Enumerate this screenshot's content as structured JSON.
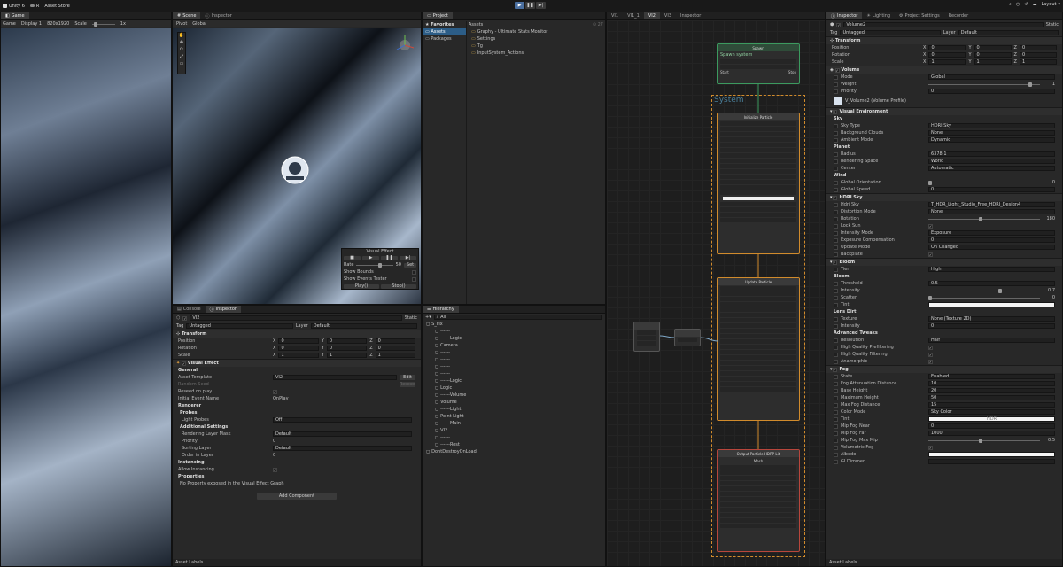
{
  "topbar": {
    "app": "Unity 6",
    "account": "R",
    "store": "Asset Store",
    "layout": "Layout"
  },
  "game": {
    "tab": "Game",
    "mode": "Game",
    "display": "Display 1",
    "res": "820x1920",
    "scale": "Scale",
    "scale_val": "1x"
  },
  "scene": {
    "tab_scene": "Scene",
    "tab_inspector": "Inspector",
    "pivot": "Pivot",
    "global": "Global",
    "persp": "Persp"
  },
  "vfx_overlay": {
    "title": "Visual Effect",
    "rate": "Rate",
    "rate_val": "50",
    "set": "Set",
    "show_bounds": "Show Bounds",
    "show_events": "Show Events Tester",
    "play": "Play()",
    "stop": "Stop()"
  },
  "project": {
    "tab": "Project",
    "favorites": "Favorites",
    "assets": "Assets",
    "packages": "Packages",
    "count": "27",
    "crumb": "Assets",
    "items": [
      "Graphy - Ultimate Stats Monitor",
      "Settings",
      "Tg",
      "InputSystem_Actions"
    ]
  },
  "vfx_tabs": [
    "VI1",
    "VI1_1",
    "VI2",
    "VI3",
    "Inspector"
  ],
  "inspector_left": {
    "tab_console": "Console",
    "tab_inspector": "Inspector",
    "name": "VI2",
    "static": "Static",
    "tag": "Tag",
    "tag_val": "Untagged",
    "layer": "Layer",
    "layer_val": "Default",
    "transform": "Transform",
    "position": "Position",
    "rotation": "Rotation",
    "scale": "Scale",
    "x": "X",
    "y": "Y",
    "z": "Z",
    "pos": [
      "0",
      "0",
      "0"
    ],
    "rot": [
      "0",
      "0",
      "0"
    ],
    "scl": [
      "1",
      "1",
      "1"
    ],
    "vfx": "Visual Effect",
    "general": "General",
    "asset_template": "Asset Template",
    "asset_val": "VI2",
    "edit": "Edit",
    "random_seed": "Random Seed",
    "reseed": "Reseed",
    "reseed_on_play": "Reseed on play",
    "initial_event": "Initial Event Name",
    "initial_event_val": "OnPlay",
    "renderer": "Renderer",
    "probes": "Probes",
    "light_probes": "Light Probes",
    "light_probes_val": "Off",
    "additional": "Additional Settings",
    "mask": "Rendering Layer Mask",
    "mask_val": "Default",
    "priority": "Priority",
    "priority_val": "0",
    "sorting": "Sorting Layer",
    "sorting_val": "Default",
    "order": "Order in Layer",
    "order_val": "0",
    "instancing": "Instancing",
    "allow_inst": "Allow Instancing",
    "properties": "Properties",
    "no_props": "No Property exposed in the Visual Effect Graph",
    "add_component": "Add Component",
    "asset_labels": "Asset Labels"
  },
  "hierarchy": {
    "tab": "Hierarchy",
    "search": "All",
    "items": [
      "S_Fix",
      "------",
      "------Logic",
      "Camera",
      "------",
      "------",
      "------",
      "------",
      "------Logic",
      "Logic",
      "------Volume",
      "Volume",
      "------Light",
      "Point Light",
      "------Main",
      "VI2",
      "------",
      "------Rest",
      "DontDestroyOnLoad"
    ]
  },
  "graph": {
    "system": "System",
    "spawn": "Spawn",
    "spawn_sys": "Spawn system",
    "init": "Initialize Particle",
    "update": "Update Particle",
    "output": "Output Particle HDRP Lit",
    "mesh": "Mesh",
    "start": "Start",
    "stop": "Stop"
  },
  "inspector_right": {
    "tab_inspector": "Inspector",
    "tab_lighting": "Lighting",
    "tab_settings": "Project Settings",
    "tab_recorder": "Recorder",
    "name": "Volume2",
    "static": "Static",
    "tag": "Tag",
    "tag_val": "Untagged",
    "layer": "Layer",
    "layer_val": "Default",
    "transform": "Transform",
    "position": "Position",
    "rotation": "Rotation",
    "scale": "Scale",
    "x": "X",
    "y": "Y",
    "z": "Z",
    "pos": [
      "0",
      "0",
      "0"
    ],
    "rot": [
      "0",
      "0",
      "0"
    ],
    "scl": [
      "1",
      "1",
      "1"
    ],
    "volume": "Volume",
    "mode": "Mode",
    "mode_val": "Global",
    "weight": "Weight",
    "weight_val": "1",
    "priority": "Priority",
    "priority_val": "0",
    "profile": "V_Volume2 (Volume Profile)",
    "visual_env": "Visual Environment",
    "sky": "Sky",
    "sky_type": "Sky Type",
    "sky_type_val": "HDRI Sky",
    "bg_clouds": "Background Clouds",
    "bg_clouds_val": "None",
    "ambient": "Ambient Mode",
    "ambient_val": "Dynamic",
    "planet": "Planet",
    "radius": "Radius",
    "radius_val": "6378.1",
    "rendering_space": "Rendering Space",
    "rendering_space_val": "World",
    "center": "Center",
    "center_val": "Automatic",
    "wind": "Wind",
    "orientation": "Global Orientation",
    "orientation_val": "0",
    "speed": "Global Speed",
    "speed_val": "0",
    "hdri": "HDRI Sky",
    "hdri_sky": "Hdri Sky",
    "hdri_sky_val": "T_HDR_Light_Studio_Free_HDRI_Design4",
    "distortion": "Distortion Mode",
    "distortion_val": "None",
    "rotation_h": "Rotation",
    "rotation_h_val": "180",
    "lock_sun": "Lock Sun",
    "intensity_mode": "Intensity Mode",
    "intensity_mode_val": "Exposure",
    "exp_comp": "Exposure Compensation",
    "exp_comp_val": "0",
    "update_mode": "Update Mode",
    "update_mode_val": "On Changed",
    "backplate": "Backplate",
    "bloom": "Bloom",
    "tier": "Tier",
    "tier_val": "High",
    "bloom2": "Bloom",
    "threshold": "Threshold",
    "threshold_val": "0.5",
    "intensity": "Intensity",
    "intensity_val": "0.7",
    "scatter": "Scatter",
    "scatter_val": "0",
    "tint": "Tint",
    "lens_dirt": "Lens Dirt",
    "texture": "Texture",
    "texture_val": "None (Texture 2D)",
    "ld_intensity": "Intensity",
    "ld_intensity_val": "0",
    "adv": "Advanced Tweaks",
    "resolution": "Resolution",
    "resolution_val": "Half",
    "hq_pref": "High Quality Prefiltering",
    "hq_filt": "High Quality Filtering",
    "anamorphic": "Anamorphic",
    "fog": "Fog",
    "state": "State",
    "state_val": "Enabled",
    "atten": "Fog Attenuation Distance",
    "atten_val": "10",
    "base_h": "Base Height",
    "base_h_val": "20",
    "max_h": "Maximum Height",
    "max_h_val": "50",
    "max_dist": "Max Fog Distance",
    "max_dist_val": "15",
    "color_mode": "Color Mode",
    "color_mode_val": "Sky Color",
    "tint2": "Tint",
    "tint2_val": "HDR",
    "mip_near": "Mip Fog Near",
    "mip_near_val": "0",
    "mip_far": "Mip Fog Far",
    "mip_far_val": "1000",
    "mip_max": "Mip Fog Max Mip",
    "mip_max_val": "0.5",
    "vol_fog": "Volumetric Fog",
    "albedo": "Albedo",
    "gi_dimmer": "GI Dimmer",
    "asset_labels": "Asset Labels"
  },
  "colors": {
    "accent": "#4a6fa0",
    "graph_green": "#3c9a5f",
    "graph_orange": "#d18b2c",
    "graph_red": "#b8463c"
  }
}
